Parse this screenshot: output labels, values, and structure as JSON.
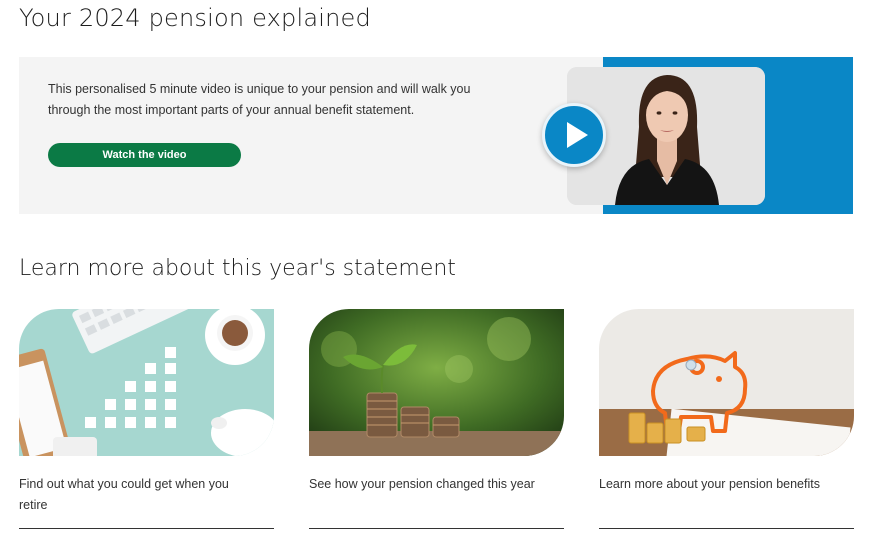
{
  "header": {
    "title": "Your 2024 pension explained"
  },
  "video": {
    "description": "This personalised 5 minute video is unique to your pension and will walk you through the most important parts of your annual benefit statement.",
    "button_label": "Watch the video",
    "play_icon": "play-icon",
    "accent_color": "#0a87c6",
    "button_color": "#0b7a45"
  },
  "learn_more": {
    "title": "Learn more about this year's statement",
    "cards": [
      {
        "label": "Find out what you could get when you retire",
        "image": "desk-calculator-piggy-bank"
      },
      {
        "label": "See how your pension changed this year",
        "image": "coins-seedling"
      },
      {
        "label": "Learn more about your pension benefits",
        "image": "piggy-bank-coins"
      }
    ]
  }
}
